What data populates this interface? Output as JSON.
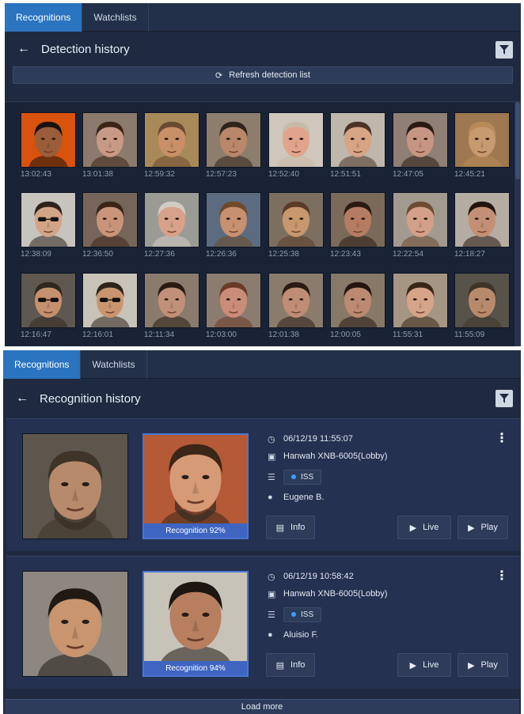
{
  "top": {
    "tabs": [
      {
        "label": "Recognitions",
        "active": true
      },
      {
        "label": "Watchlists",
        "active": false
      }
    ],
    "title": "Detection history",
    "refresh_label": "Refresh detection list",
    "detections": [
      {
        "time": "13:02:43",
        "skin": "#9a5d3a",
        "hair": "#1a120d",
        "bg": "#d9520e"
      },
      {
        "time": "13:01:38",
        "skin": "#c89a86",
        "hair": "#3a2516",
        "bg": "#8c7a6c"
      },
      {
        "time": "12:59:32",
        "skin": "#c98f66",
        "hair": "#6a4a30",
        "bg": "#a88a5a"
      },
      {
        "time": "12:57:23",
        "skin": "#b9876a",
        "hair": "#2e241c",
        "bg": "#8d7d6c"
      },
      {
        "time": "12:52:40",
        "skin": "#e0a48c",
        "hair": "#c9b9a7",
        "bg": "#cfc7bb"
      },
      {
        "time": "12:51:51",
        "skin": "#d7a486",
        "hair": "#4a3426",
        "bg": "#bfb7ac"
      },
      {
        "time": "12:47:05",
        "skin": "#c79682",
        "hair": "#2a1a12",
        "bg": "#8f7f74"
      },
      {
        "time": "12:45:21",
        "skin": "#c79a6f",
        "hair": "#b88a58",
        "bg": "#9d7850"
      },
      {
        "time": "12:38:09",
        "skin": "#d2a486",
        "hair": "#2d241d",
        "bg": "#c7c3bd"
      },
      {
        "time": "12:36:50",
        "skin": "#c99479",
        "hair": "#3a2518",
        "bg": "#766659"
      },
      {
        "time": "12:27:36",
        "skin": "#d8a28a",
        "hair": "#d0ccc4",
        "bg": "#9b9b96"
      },
      {
        "time": "12:26:36",
        "skin": "#c79070",
        "hair": "#6e4a2a",
        "bg": "#5c6b7f"
      },
      {
        "time": "12:25:38",
        "skin": "#c7976d",
        "hair": "#5a3b28",
        "bg": "#7d6f60"
      },
      {
        "time": "12:23:43",
        "skin": "#b67c62",
        "hair": "#2a1a12",
        "bg": "#7b6a5a"
      },
      {
        "time": "12:22:54",
        "skin": "#d4a08a",
        "hair": "#6c4b32",
        "bg": "#a29a8e"
      },
      {
        "time": "12:18:27",
        "skin": "#c39075",
        "hair": "#22150f",
        "bg": "#b5aca3"
      },
      {
        "time": "12:16:47",
        "skin": "#c4906d",
        "hair": "#2f2821",
        "bg": "#5f5850"
      },
      {
        "time": "12:16:01",
        "skin": "#c8956f",
        "hair": "#2d241c",
        "bg": "#c8c2b8"
      },
      {
        "time": "12:11:34",
        "skin": "#c09078",
        "hair": "#2a1b12",
        "bg": "#8a7b6c"
      },
      {
        "time": "12:03:00",
        "skin": "#c98d78",
        "hair": "#6a3a28",
        "bg": "#8c7c6f"
      },
      {
        "time": "12:01:38",
        "skin": "#bf8d73",
        "hair": "#2b1c13",
        "bg": "#8b7b6d"
      },
      {
        "time": "12:00:05",
        "skin": "#bb8a70",
        "hair": "#24160f",
        "bg": "#887868"
      },
      {
        "time": "11:55:31",
        "skin": "#d6a488",
        "hair": "#3a2616",
        "bg": "#a59583"
      },
      {
        "time": "11:55:09",
        "skin": "#b88a6c",
        "hair": "#3e3428",
        "bg": "#57524a"
      }
    ]
  },
  "bottom": {
    "tabs": [
      {
        "label": "Recognitions",
        "active": true
      },
      {
        "label": "Watchlists",
        "active": false
      }
    ],
    "title": "Recognition history",
    "records": [
      {
        "datetime": "06/12/19 11:55:07",
        "camera": "Hanwah XNB-6005(Lobby)",
        "watchlist": "ISS",
        "person": "Eugene B.",
        "recognition": "Recognition 92%",
        "live_face": {
          "skin": "#b88a6c",
          "hair": "#3e3428",
          "bg": "#5d564d",
          "beard": true
        },
        "match_face": {
          "skin": "#d69a76",
          "hair": "#3b2618",
          "bg": "#b45a37",
          "beard": true
        }
      },
      {
        "datetime": "06/12/19 10:58:42",
        "camera": "Hanwah XNB-6005(Lobby)",
        "watchlist": "ISS",
        "person": "Aluisio F.",
        "recognition": "Recognition 94%",
        "live_face": {
          "skin": "#c8956f",
          "hair": "#211a14",
          "bg": "#8d8780",
          "beard": false
        },
        "match_face": {
          "skin": "#b77f5f",
          "hair": "#1d1611",
          "bg": "#c8c3b9",
          "beard": false
        }
      }
    ],
    "buttons": {
      "info": "Info",
      "live": "Live",
      "play": "Play",
      "load_more": "Load more"
    }
  },
  "colors": {
    "panel_bg": "#1f2a40",
    "active_tab": "#2a74c0",
    "recognition_label": "#3e65c2",
    "iss_dot": "#3aa0ff"
  }
}
